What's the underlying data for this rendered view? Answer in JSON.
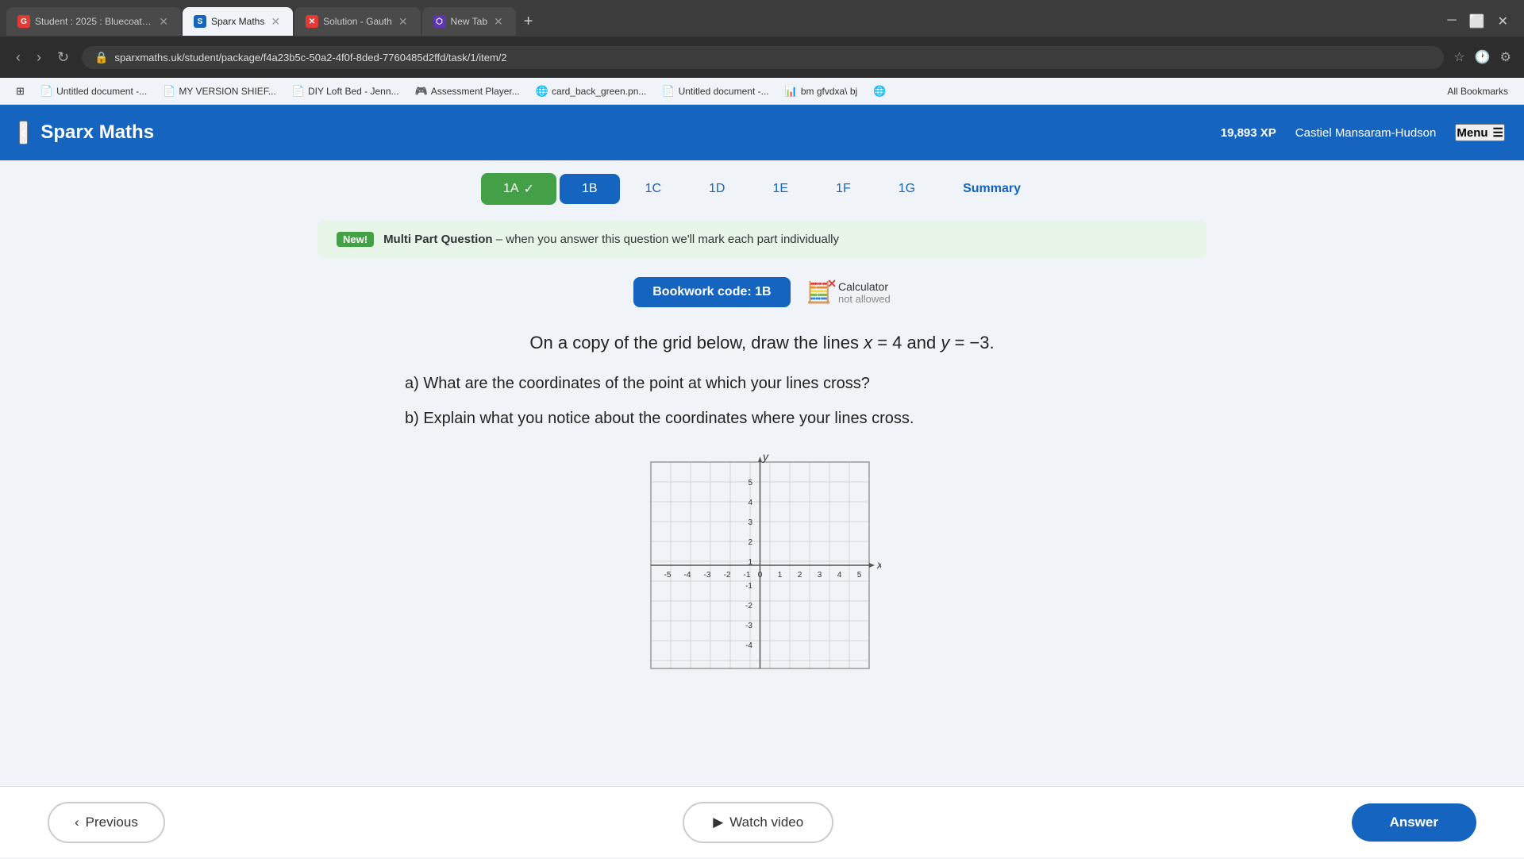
{
  "browser": {
    "tabs": [
      {
        "id": "go",
        "label": "Student : 2025 : Bluecoat Trent...",
        "favicon_char": "G",
        "favicon_color": "#e53935",
        "active": false
      },
      {
        "id": "sparx",
        "label": "Sparx Maths",
        "favicon_char": "S",
        "favicon_color": "#1565c0",
        "active": true
      },
      {
        "id": "solution",
        "label": "Solution - Gauth",
        "favicon_char": "✕",
        "favicon_color": "#e53935",
        "active": false
      },
      {
        "id": "newtab",
        "label": "New Tab",
        "favicon_char": "⬡",
        "favicon_color": "#5e35b1",
        "active": false
      }
    ],
    "url": "sparxmaths.uk/student/package/f4a23b5c-50a2-4f0f-8ded-7760485d2ffd/task/1/item/2",
    "bookmarks": [
      {
        "icon": "📄",
        "label": "Untitled document -..."
      },
      {
        "icon": "📄",
        "label": "MY VERSION SHIEF..."
      },
      {
        "icon": "🛏",
        "label": "DIY Loft Bed - Jenn..."
      },
      {
        "icon": "🎮",
        "label": "Assessment Player..."
      },
      {
        "icon": "🌐",
        "label": "card_back_green.pn..."
      },
      {
        "icon": "📄",
        "label": "Untitled document -..."
      },
      {
        "icon": "📊",
        "label": "bm gfvdxa\\ bj"
      },
      {
        "icon": "🌐",
        "label": ""
      }
    ],
    "all_bookmarks_label": "All Bookmarks"
  },
  "header": {
    "logo": "Sparx Maths",
    "xp": "19,893 XP",
    "user": "Castiel Mansaram-Hudson",
    "menu_label": "Menu"
  },
  "nav_tabs": [
    {
      "id": "1A",
      "label": "1A",
      "state": "completed"
    },
    {
      "id": "1B",
      "label": "1B",
      "state": "active"
    },
    {
      "id": "1C",
      "label": "1C",
      "state": "inactive"
    },
    {
      "id": "1D",
      "label": "1D",
      "state": "inactive"
    },
    {
      "id": "1E",
      "label": "1E",
      "state": "inactive"
    },
    {
      "id": "1F",
      "label": "1F",
      "state": "inactive"
    },
    {
      "id": "1G",
      "label": "1G",
      "state": "inactive"
    },
    {
      "id": "summary",
      "label": "Summary",
      "state": "summary"
    }
  ],
  "banner": {
    "badge": "New!",
    "text": "Multi Part Question – when you answer this question we'll mark each part individually"
  },
  "bookwork": {
    "code_label": "Bookwork code: 1B",
    "calc_label": "Calculator",
    "calc_status": "not allowed"
  },
  "question": {
    "main": "On a copy of the grid below, draw the lines x = 4 and y = −3.",
    "part_a": "a) What are the coordinates of the point at which your lines cross?",
    "part_b": "b) Explain what you notice about the coordinates where your lines cross."
  },
  "graph": {
    "x_min": -5,
    "x_max": 5,
    "y_min": -5,
    "y_max": 5,
    "x_label": "x",
    "y_label": "y"
  },
  "buttons": {
    "previous": "Previous",
    "watch_video": "Watch video",
    "answer": "Answer"
  }
}
